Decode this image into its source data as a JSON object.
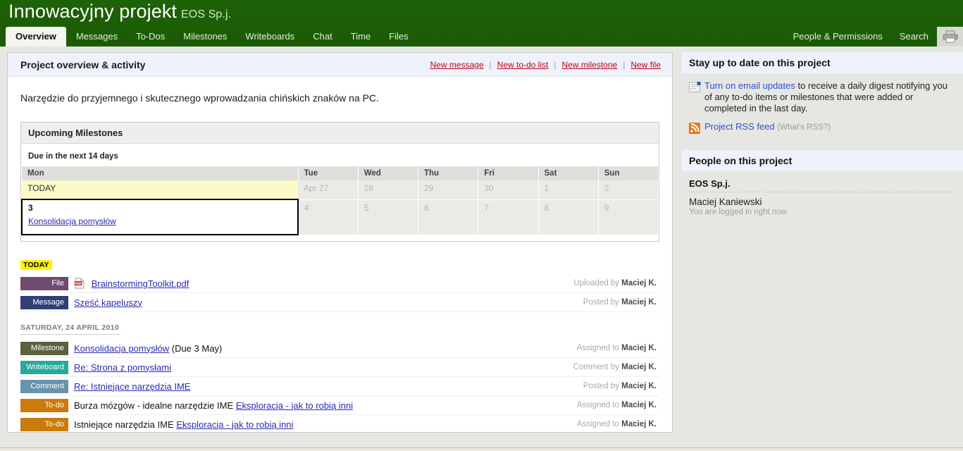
{
  "header": {
    "project_title": "Innowacyjny projekt",
    "company": "EOS Sp.j.",
    "tabs": [
      {
        "label": "Overview",
        "active": true
      },
      {
        "label": "Messages",
        "active": false
      },
      {
        "label": "To-Dos",
        "active": false
      },
      {
        "label": "Milestones",
        "active": false
      },
      {
        "label": "Writeboards",
        "active": false
      },
      {
        "label": "Chat",
        "active": false
      },
      {
        "label": "Time",
        "active": false
      },
      {
        "label": "Files",
        "active": false
      }
    ],
    "right_tabs": [
      {
        "label": "People & Permissions"
      },
      {
        "label": "Search"
      }
    ],
    "print_icon": "printer-icon",
    "bar_color": "#1d6107"
  },
  "main": {
    "title": "Project overview & activity",
    "actions": [
      {
        "label": "New message"
      },
      {
        "label": "New to-do list"
      },
      {
        "label": "New milestone"
      },
      {
        "label": "New file"
      }
    ],
    "action_color": "#c00018",
    "description": "Narzędzie do przyjemnego i skutecznego wprowadzania chińskich znaków na PC."
  },
  "milestones": {
    "title": "Upcoming Milestones",
    "subtitle": "Due in the next 14 days",
    "day_headers": [
      "Mon",
      "Tue",
      "Wed",
      "Thu",
      "Fri",
      "Sat",
      "Sun"
    ],
    "week1": [
      {
        "label": "TODAY",
        "type": "today"
      },
      {
        "label": "Apr 27",
        "type": "dim"
      },
      {
        "label": "28",
        "type": "dim"
      },
      {
        "label": "29",
        "type": "dim"
      },
      {
        "label": "30",
        "type": "dim"
      },
      {
        "label": "1",
        "type": "dim"
      },
      {
        "label": "2",
        "type": "dim"
      }
    ],
    "week2": [
      {
        "label": "3",
        "type": "focus",
        "link": "Konsolidacja pomysłów"
      },
      {
        "label": "4",
        "type": "dim"
      },
      {
        "label": "5",
        "type": "dim"
      },
      {
        "label": "6",
        "type": "dim"
      },
      {
        "label": "7",
        "type": "dim"
      },
      {
        "label": "8",
        "type": "dim"
      },
      {
        "label": "9",
        "type": "dim"
      }
    ],
    "today_bg": "#fcfac8"
  },
  "feed": {
    "groups": [
      {
        "label": "TODAY",
        "style": "today",
        "items": [
          {
            "badge": "File",
            "badge_color": "#6f4b70",
            "icon": "pdf-file-icon",
            "link": "BrainstormingToolkit.pdf",
            "text_before": "",
            "text_after": "",
            "link2": "",
            "meta_prefix": "Uploaded by",
            "meta_person": "Maciej K."
          },
          {
            "badge": "Message",
            "badge_color": "#2f4077",
            "icon": "",
            "link": "Sześć kapeluszy",
            "text_before": "",
            "text_after": "",
            "link2": "",
            "meta_prefix": "Posted by",
            "meta_person": "Maciej K."
          }
        ]
      },
      {
        "label": "SATURDAY, 24 APRIL 2010",
        "style": "divider",
        "items": [
          {
            "badge": "Milestone",
            "badge_color": "#5d6041",
            "icon": "",
            "link": "Konsolidacja pomysłów",
            "text_before": "",
            "text_after": " (Due 3 May)",
            "link2": "",
            "meta_prefix": "Assigned to",
            "meta_person": "Maciej K."
          },
          {
            "badge": "Writeboard",
            "badge_color": "#27aa98",
            "icon": "",
            "link": "Re: Strona z pomysłami",
            "text_before": "",
            "text_after": "",
            "link2": "",
            "meta_prefix": "Comment by",
            "meta_person": "Maciej K."
          },
          {
            "badge": "Comment",
            "badge_color": "#6a93ab",
            "icon": "",
            "link": "Re: Istniejące narzędzia IME",
            "text_before": "",
            "text_after": "",
            "link2": "",
            "meta_prefix": "Posted by",
            "meta_person": "Maciej K."
          },
          {
            "badge": "To-do",
            "badge_color": "#cc7a0a",
            "icon": "",
            "link": "",
            "text_before": "Burza mózgów - idealne narzędzie IME ",
            "text_after": "",
            "link2": "Eksploracja - jak to robią inni",
            "meta_prefix": "Assigned to",
            "meta_person": "Maciej K."
          },
          {
            "badge": "To-do",
            "badge_color": "#cc7a0a",
            "icon": "",
            "link": "",
            "text_before": "Istniejące narzędzia IME ",
            "text_after": "",
            "link2": "Eksploracja - jak to robią inni",
            "meta_prefix": "Assigned to",
            "meta_person": "Maciej K."
          }
        ]
      }
    ]
  },
  "sidebar": {
    "stay_title": "Stay up to date on this project",
    "email_link": "Turn on email updates",
    "email_rest": " to receive a daily digest notifying you of any to-do items or milestones that were added or completed in the last day.",
    "rss_link": "Project RSS feed",
    "rss_hint": "(What's RSS?)",
    "people_title": "People on this project",
    "company": "EOS Sp.j.",
    "person_name": "Maciej Kaniewski",
    "person_status": "You are logged in right now",
    "link_color": "#2a55c8"
  }
}
